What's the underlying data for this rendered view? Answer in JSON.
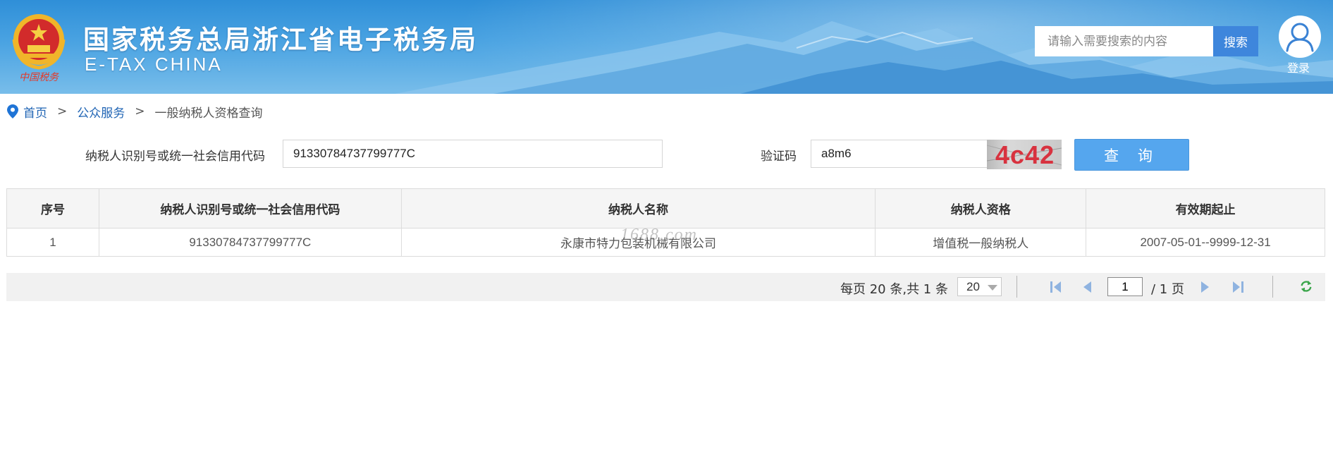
{
  "header": {
    "site_title": "国家税务总局浙江省电子税务局",
    "site_subtitle": "E-TAX CHINA",
    "emblem_caption": "中国税务",
    "search_placeholder": "请输入需要搜索的内容",
    "search_button": "搜索",
    "login_label": "登录"
  },
  "breadcrumb": {
    "home": "首页",
    "sep1": ">",
    "public_service": "公众服务",
    "sep2": ">",
    "current": "一般纳税人资格查询"
  },
  "query_form": {
    "taxpayer_id_label": "纳税人识别号或统一社会信用代码",
    "taxpayer_id_value": "91330784737799777C",
    "captcha_label": "验证码",
    "captcha_input_value": "a8m6",
    "captcha_image_text": "4c42",
    "query_button": "查 询"
  },
  "table": {
    "headers": [
      "序号",
      "纳税人识别号或统一社会信用代码",
      "纳税人名称",
      "纳税人资格",
      "有效期起止"
    ],
    "rows": [
      [
        "1",
        "91330784737799777C",
        "永康市特力包装机械有限公司",
        "增值税一般纳税人",
        "2007-05-01--9999-12-31"
      ]
    ],
    "watermark": "1688.com"
  },
  "pagination": {
    "summary": "每页 20 条,共 1 条",
    "page_size": "20",
    "current_page": "1",
    "total_pages": "/ 1 页"
  },
  "colors": {
    "header_blue": "#2f8fd8",
    "search_button": "#3e86dc",
    "query_button": "#55a6ee",
    "link": "#1f64b4",
    "captcha_text": "#d8323f"
  }
}
